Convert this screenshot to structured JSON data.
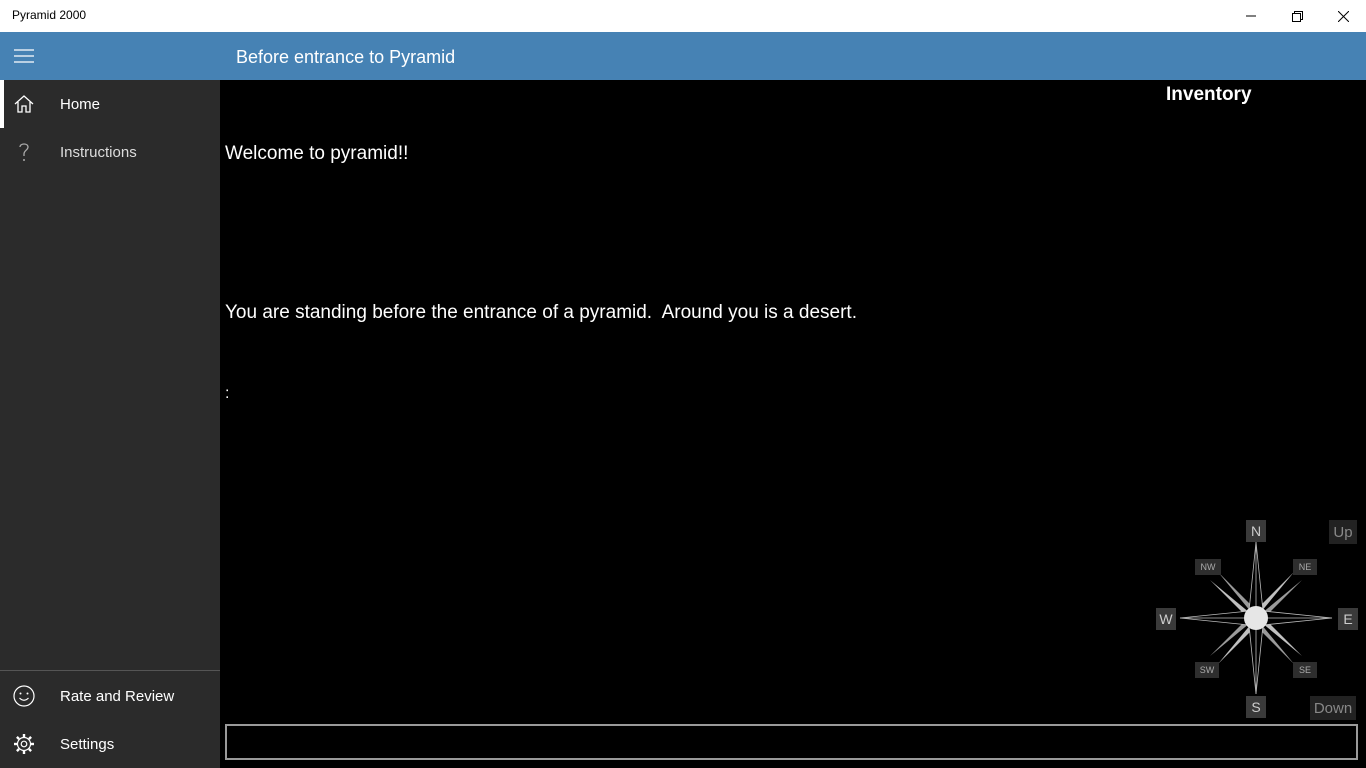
{
  "window": {
    "title": "Pyramid 2000"
  },
  "header": {
    "title": "Before entrance to Pyramid"
  },
  "sidebar": {
    "items": [
      {
        "label": "Home",
        "icon": "home-icon",
        "selected": true
      },
      {
        "label": "Instructions",
        "icon": "question-icon",
        "selected": false
      }
    ],
    "footer_items": [
      {
        "label": "Rate and Review",
        "icon": "smiley-icon"
      },
      {
        "label": "Settings",
        "icon": "gear-icon"
      }
    ]
  },
  "main": {
    "output_lines": [
      "Welcome to pyramid!!",
      "",
      "You are standing before the entrance of a pyramid.  Around you is a desert.",
      ":"
    ],
    "inventory_title": "Inventory",
    "command_value": ""
  },
  "compass": {
    "n": "N",
    "s": "S",
    "e": "E",
    "w": "W",
    "ne": "NE",
    "nw": "NW",
    "se": "SE",
    "sw": "SW",
    "up": "Up",
    "down": "Down"
  },
  "colors": {
    "header": "#4682b4",
    "sidebar": "#2b2b2b",
    "content": "#000000"
  }
}
